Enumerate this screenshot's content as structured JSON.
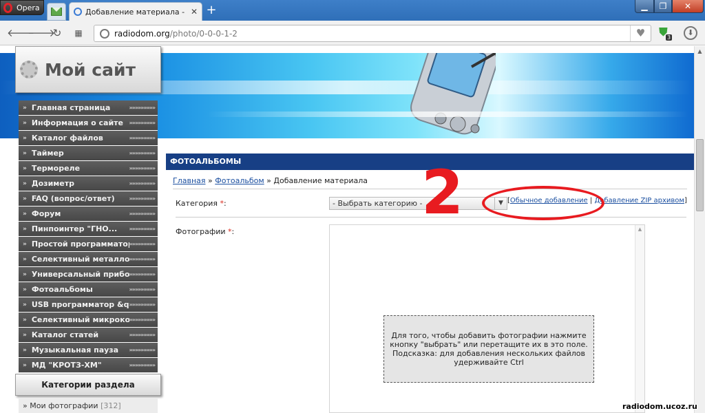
{
  "browser": {
    "menu_label": "Opera",
    "tab_title": "Добавление материала - Ф",
    "url_host": "radiodom.org",
    "url_path": "/photo/0-0-0-1-2",
    "extension_badge": "3"
  },
  "site": {
    "logo_text": "Мой сайт"
  },
  "sidebar": {
    "items": [
      {
        "label": "Главная страница"
      },
      {
        "label": "Информация о сайте"
      },
      {
        "label": "Каталог файлов"
      },
      {
        "label": "Таймер"
      },
      {
        "label": "Термореле"
      },
      {
        "label": "Дозиметр"
      },
      {
        "label": "FAQ (вопрос/ответ)"
      },
      {
        "label": "Форум"
      },
      {
        "label": "Пинпоинтер \"ГНО..."
      },
      {
        "label": "Простой программатор..."
      },
      {
        "label": "Селективный металло..."
      },
      {
        "label": "Универсальный прибор,,,"
      },
      {
        "label": "Фотоальбомы"
      },
      {
        "label": "USB программатор &qu..."
      },
      {
        "label": "Селективный микроком..."
      },
      {
        "label": "Каталог статей"
      },
      {
        "label": "Музыкальная пауза"
      },
      {
        "label": "МД \"КРОТЗ-ХМ\""
      }
    ],
    "arrows": "»»»»»»»»»",
    "categories_title": "Категории раздела",
    "category": {
      "label": "Мои фотографии",
      "count": "[312]"
    }
  },
  "main": {
    "section_title": "ФОТОАЛЬБОМЫ",
    "breadcrumb": {
      "home": "Главная",
      "sep": "»",
      "albums": "Фотоальбом",
      "current": "Добавление материала"
    },
    "category_label": "Категория",
    "required_mark": "*",
    "category_select": "- Выбрать категорию -",
    "link_normal": "Обычное добавление",
    "link_zip": "Добавление ZIP архивом",
    "photos_label": "Фотографии",
    "dropzone_hint": "Для того, чтобы добавить фотографии нажмите кнопку \"выбрать\" или перетащите их в это поле. Подсказка: для добавления нескольких файлов удерживайте Ctrl"
  },
  "annotation": {
    "number": "2",
    "color": "#e81b20"
  },
  "watermark": "radiodom.ucoz.ru"
}
